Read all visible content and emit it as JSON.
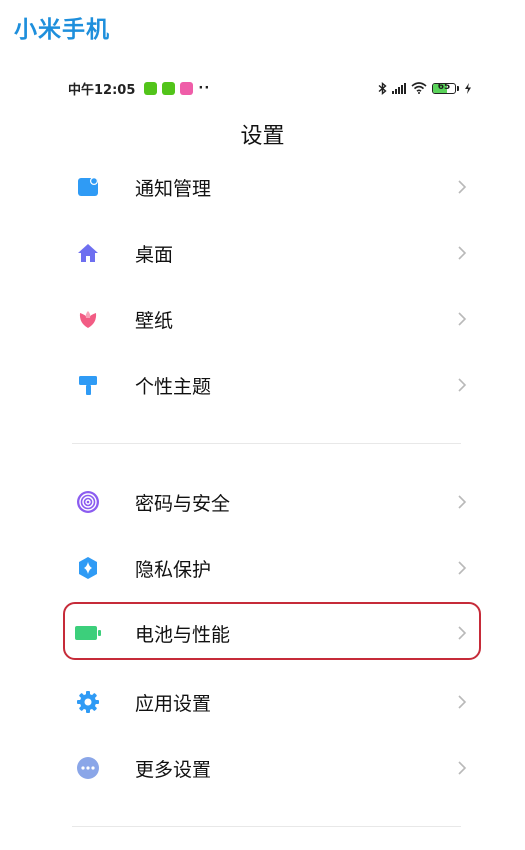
{
  "app_title": "小米手机",
  "status_bar": {
    "time": "中午12:05",
    "overflow_dots": "··",
    "battery_level": "65",
    "battery_fraction": 0.65,
    "bluetooth_icon": "bluetooth-icon",
    "signal_icon": "signal-icon",
    "wifi_icon": "wifi-icon",
    "charging_icon": "lightning-icon"
  },
  "page_title": "设置",
  "section1": [
    {
      "label": "通知管理",
      "icon": "notification-icon",
      "color": "#2f9bf5"
    },
    {
      "label": "桌面",
      "icon": "home-icon",
      "color": "#6e6ff0"
    },
    {
      "label": "壁纸",
      "icon": "tulip-icon",
      "color": "#f25c84"
    },
    {
      "label": "个性主题",
      "icon": "paint-roller-icon",
      "color": "#2f9bf5"
    }
  ],
  "section2": [
    {
      "label": "密码与安全",
      "icon": "fingerprint-icon",
      "color": "#8b5cf0"
    },
    {
      "label": "隐私保护",
      "icon": "privacy-shield-icon",
      "color": "#2f9bf5"
    },
    {
      "label": "电池与性能",
      "icon": "battery-icon",
      "color": "#3ccf7b",
      "highlighted": true
    },
    {
      "label": "应用设置",
      "icon": "gear-icon",
      "color": "#2f9bf5"
    },
    {
      "label": "更多设置",
      "icon": "more-dots-icon",
      "color": "#8aa6e8"
    }
  ],
  "colors": {
    "accent": "#1e8fdc",
    "highlight_border": "#c62b39"
  }
}
